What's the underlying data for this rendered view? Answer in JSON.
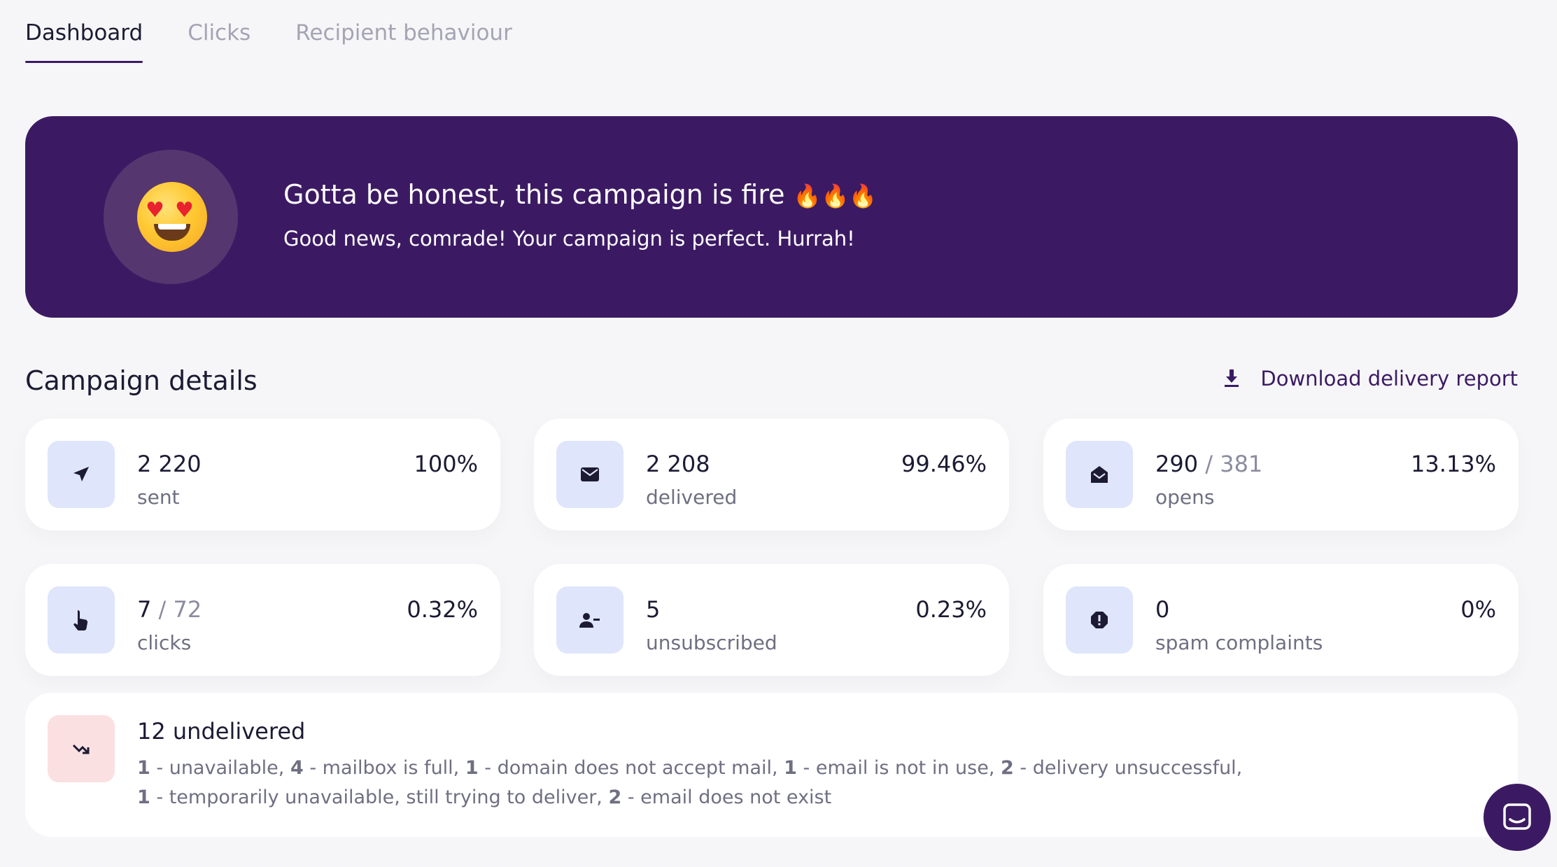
{
  "tabs": [
    {
      "label": "Dashboard",
      "active": true
    },
    {
      "label": "Clicks",
      "active": false
    },
    {
      "label": "Recipient behaviour",
      "active": false
    }
  ],
  "hero": {
    "emoji": "heart-eyes-emoji",
    "title": "Gotta be honest, this campaign is fire",
    "title_emoji": "🔥🔥🔥",
    "subtitle": "Good news, comrade! Your campaign is perfect. Hurrah!",
    "background_color": "#3c1a63"
  },
  "campaign_details": {
    "title": "Campaign details",
    "download_label": "Download delivery report",
    "download_icon": "download-icon"
  },
  "stats": [
    {
      "id": "sent",
      "icon": "send-icon",
      "value": "2 220",
      "total": "",
      "label": "sent",
      "percent": "100%"
    },
    {
      "id": "delivered",
      "icon": "envelope-icon",
      "value": "2 208",
      "total": "",
      "label": "delivered",
      "percent": "99.46%"
    },
    {
      "id": "opens",
      "icon": "open-envelope-icon",
      "value": "290",
      "total": "381",
      "label": "opens",
      "percent": "13.13%"
    },
    {
      "id": "clicks",
      "icon": "pointer-hand-icon",
      "value": "7",
      "total": "72",
      "label": "clicks",
      "percent": "0.32%"
    },
    {
      "id": "unsubscribed",
      "icon": "user-minus-icon",
      "value": "5",
      "total": "",
      "label": "unsubscribed",
      "percent": "0.23%"
    },
    {
      "id": "spam",
      "icon": "alert-icon",
      "value": "0",
      "total": "",
      "label": "spam complaints",
      "percent": "0%"
    }
  ],
  "undelivered": {
    "title": "12 undelivered",
    "icon": "arrow-down-right-icon",
    "line1": [
      {
        "count": "1",
        "reason": " - unavailable, "
      },
      {
        "count": "4",
        "reason": " - mailbox is full, "
      },
      {
        "count": "1",
        "reason": " - domain does not accept mail, "
      },
      {
        "count": "1",
        "reason": " - email is not in use, "
      },
      {
        "count": "2",
        "reason": " - delivery unsuccessful,"
      }
    ],
    "line2": [
      {
        "count": "1",
        "reason": " - temporarily unavailable, still trying to deliver, "
      },
      {
        "count": "2",
        "reason": " - email does not exist"
      }
    ]
  },
  "chat_widget": {
    "icon": "chat-icon"
  },
  "colors": {
    "accent": "#3c1a63",
    "icon_bg": "#dfe5fb",
    "danger_bg": "#fbe0e1",
    "page_bg": "#f6f6f8"
  }
}
